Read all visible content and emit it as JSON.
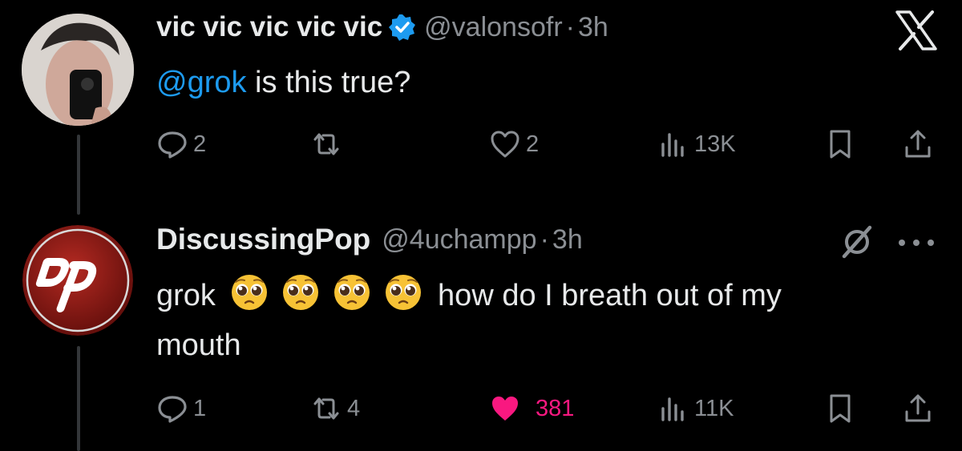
{
  "tweets": [
    {
      "name": "vic vic vic vic vic",
      "handle": "@valonsofr",
      "time": "3h",
      "verified": true,
      "text_mention": "@grok",
      "text": " is this true?",
      "replies": "2",
      "reposts": "",
      "likes": "2",
      "views": "13K",
      "liked": false
    },
    {
      "name": "DiscussingPop",
      "handle": "@4uchampp",
      "time": "3h",
      "verified": false,
      "text_before": "grok",
      "emojis": [
        "pleading-face",
        "pleading-face",
        "pleading-face",
        "pleading-face"
      ],
      "text_after": "how do I breath out of my",
      "text_line2": "mouth",
      "replies": "1",
      "reposts": "4",
      "likes": "381",
      "views": "11K",
      "liked": true
    }
  ],
  "colors": {
    "mention": "#1d9bf0",
    "like_active": "#f91880",
    "muted": "#8b8f94",
    "text": "#e7e9ea"
  },
  "avatar2_logo_text": "DP"
}
